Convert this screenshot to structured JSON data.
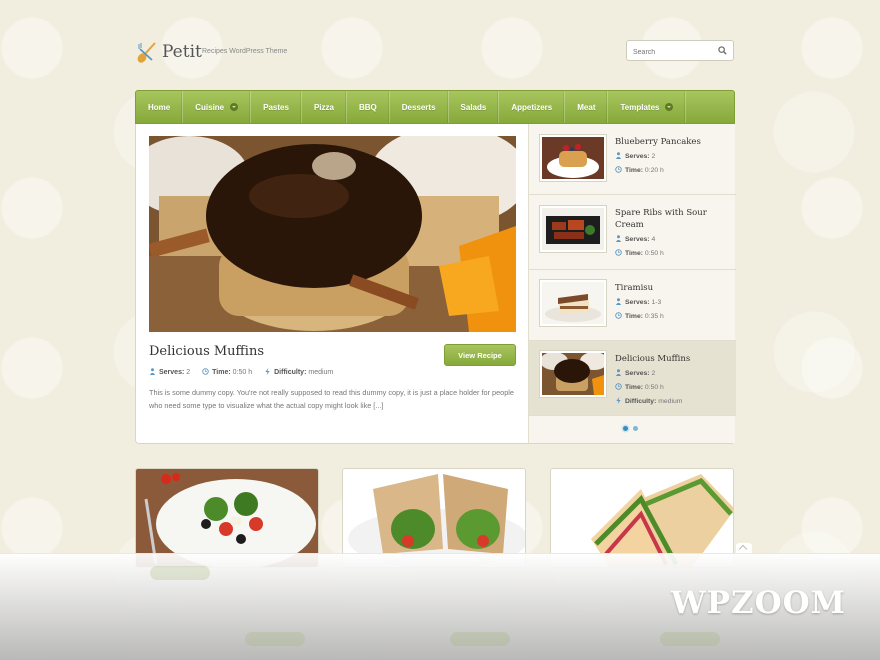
{
  "brand": {
    "title": "Petit",
    "tagline": "Recipes WordPress Theme"
  },
  "search": {
    "placeholder": "Search"
  },
  "nav": {
    "items": [
      {
        "label": "Home"
      },
      {
        "label": "Cuisine",
        "has_dropdown": true
      },
      {
        "label": "Pastes"
      },
      {
        "label": "Pizza"
      },
      {
        "label": "BBQ"
      },
      {
        "label": "Desserts"
      },
      {
        "label": "Salads"
      },
      {
        "label": "Appetizers"
      },
      {
        "label": "Meat"
      },
      {
        "label": "Templates",
        "has_dropdown": true
      }
    ]
  },
  "featured": {
    "title": "Delicious Muffins",
    "button_label": "View Recipe",
    "serves_label": "Serves:",
    "serves": "2",
    "time_label": "Time:",
    "time": "0:50 h",
    "difficulty_label": "Difficulty:",
    "difficulty": "medium",
    "excerpt": "This is some dummy copy. You're not really supposed to read this dummy copy, it is just a place holder for people who need some type to visualize what the actual copy might look like [...]"
  },
  "sidebar": {
    "items": [
      {
        "title": "Blueberry Pancakes",
        "serves_label": "Serves:",
        "serves": "2",
        "time_label": "Time:",
        "time": "0:20 h"
      },
      {
        "title": "Spare Ribs with Sour Cream",
        "serves_label": "Serves:",
        "serves": "4",
        "time_label": "Time:",
        "time": "0:50 h"
      },
      {
        "title": "Tiramisu",
        "serves_label": "Serves:",
        "serves": "1-3",
        "time_label": "Time:",
        "time": "0:35 h"
      },
      {
        "title": "Delicious Muffins",
        "serves_label": "Serves:",
        "serves": "2",
        "time_label": "Time:",
        "time": "0:50 h",
        "difficulty_label": "Difficulty:",
        "difficulty": "medium"
      }
    ]
  },
  "slider": {
    "active_dot": 1
  },
  "watermark": "WPZOOM",
  "colors": {
    "accent_green": "#94b447",
    "link_blue": "#3b8bbd"
  }
}
